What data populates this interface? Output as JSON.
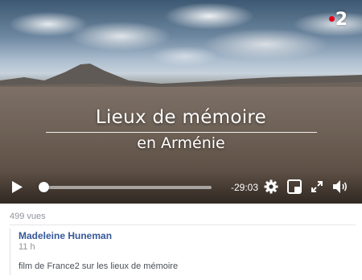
{
  "video": {
    "channel_logo": "2",
    "title_main": "Lieux de mémoire",
    "title_sub": "en Arménie",
    "time_remaining": "-29:03",
    "progress": 0.0
  },
  "post": {
    "views": "499 vues",
    "author": "Madeleine Huneman",
    "timeago": "11 h",
    "text": "film de France2 sur les lieux de mémoire"
  },
  "colors": {
    "link_blue": "#365899",
    "meta_gray": "#90949c",
    "logo_red": "#e2001a"
  },
  "icons": [
    "play-icon",
    "settings-gear-icon",
    "miniplayer-icon",
    "fullscreen-expand-icon",
    "volume-icon"
  ]
}
